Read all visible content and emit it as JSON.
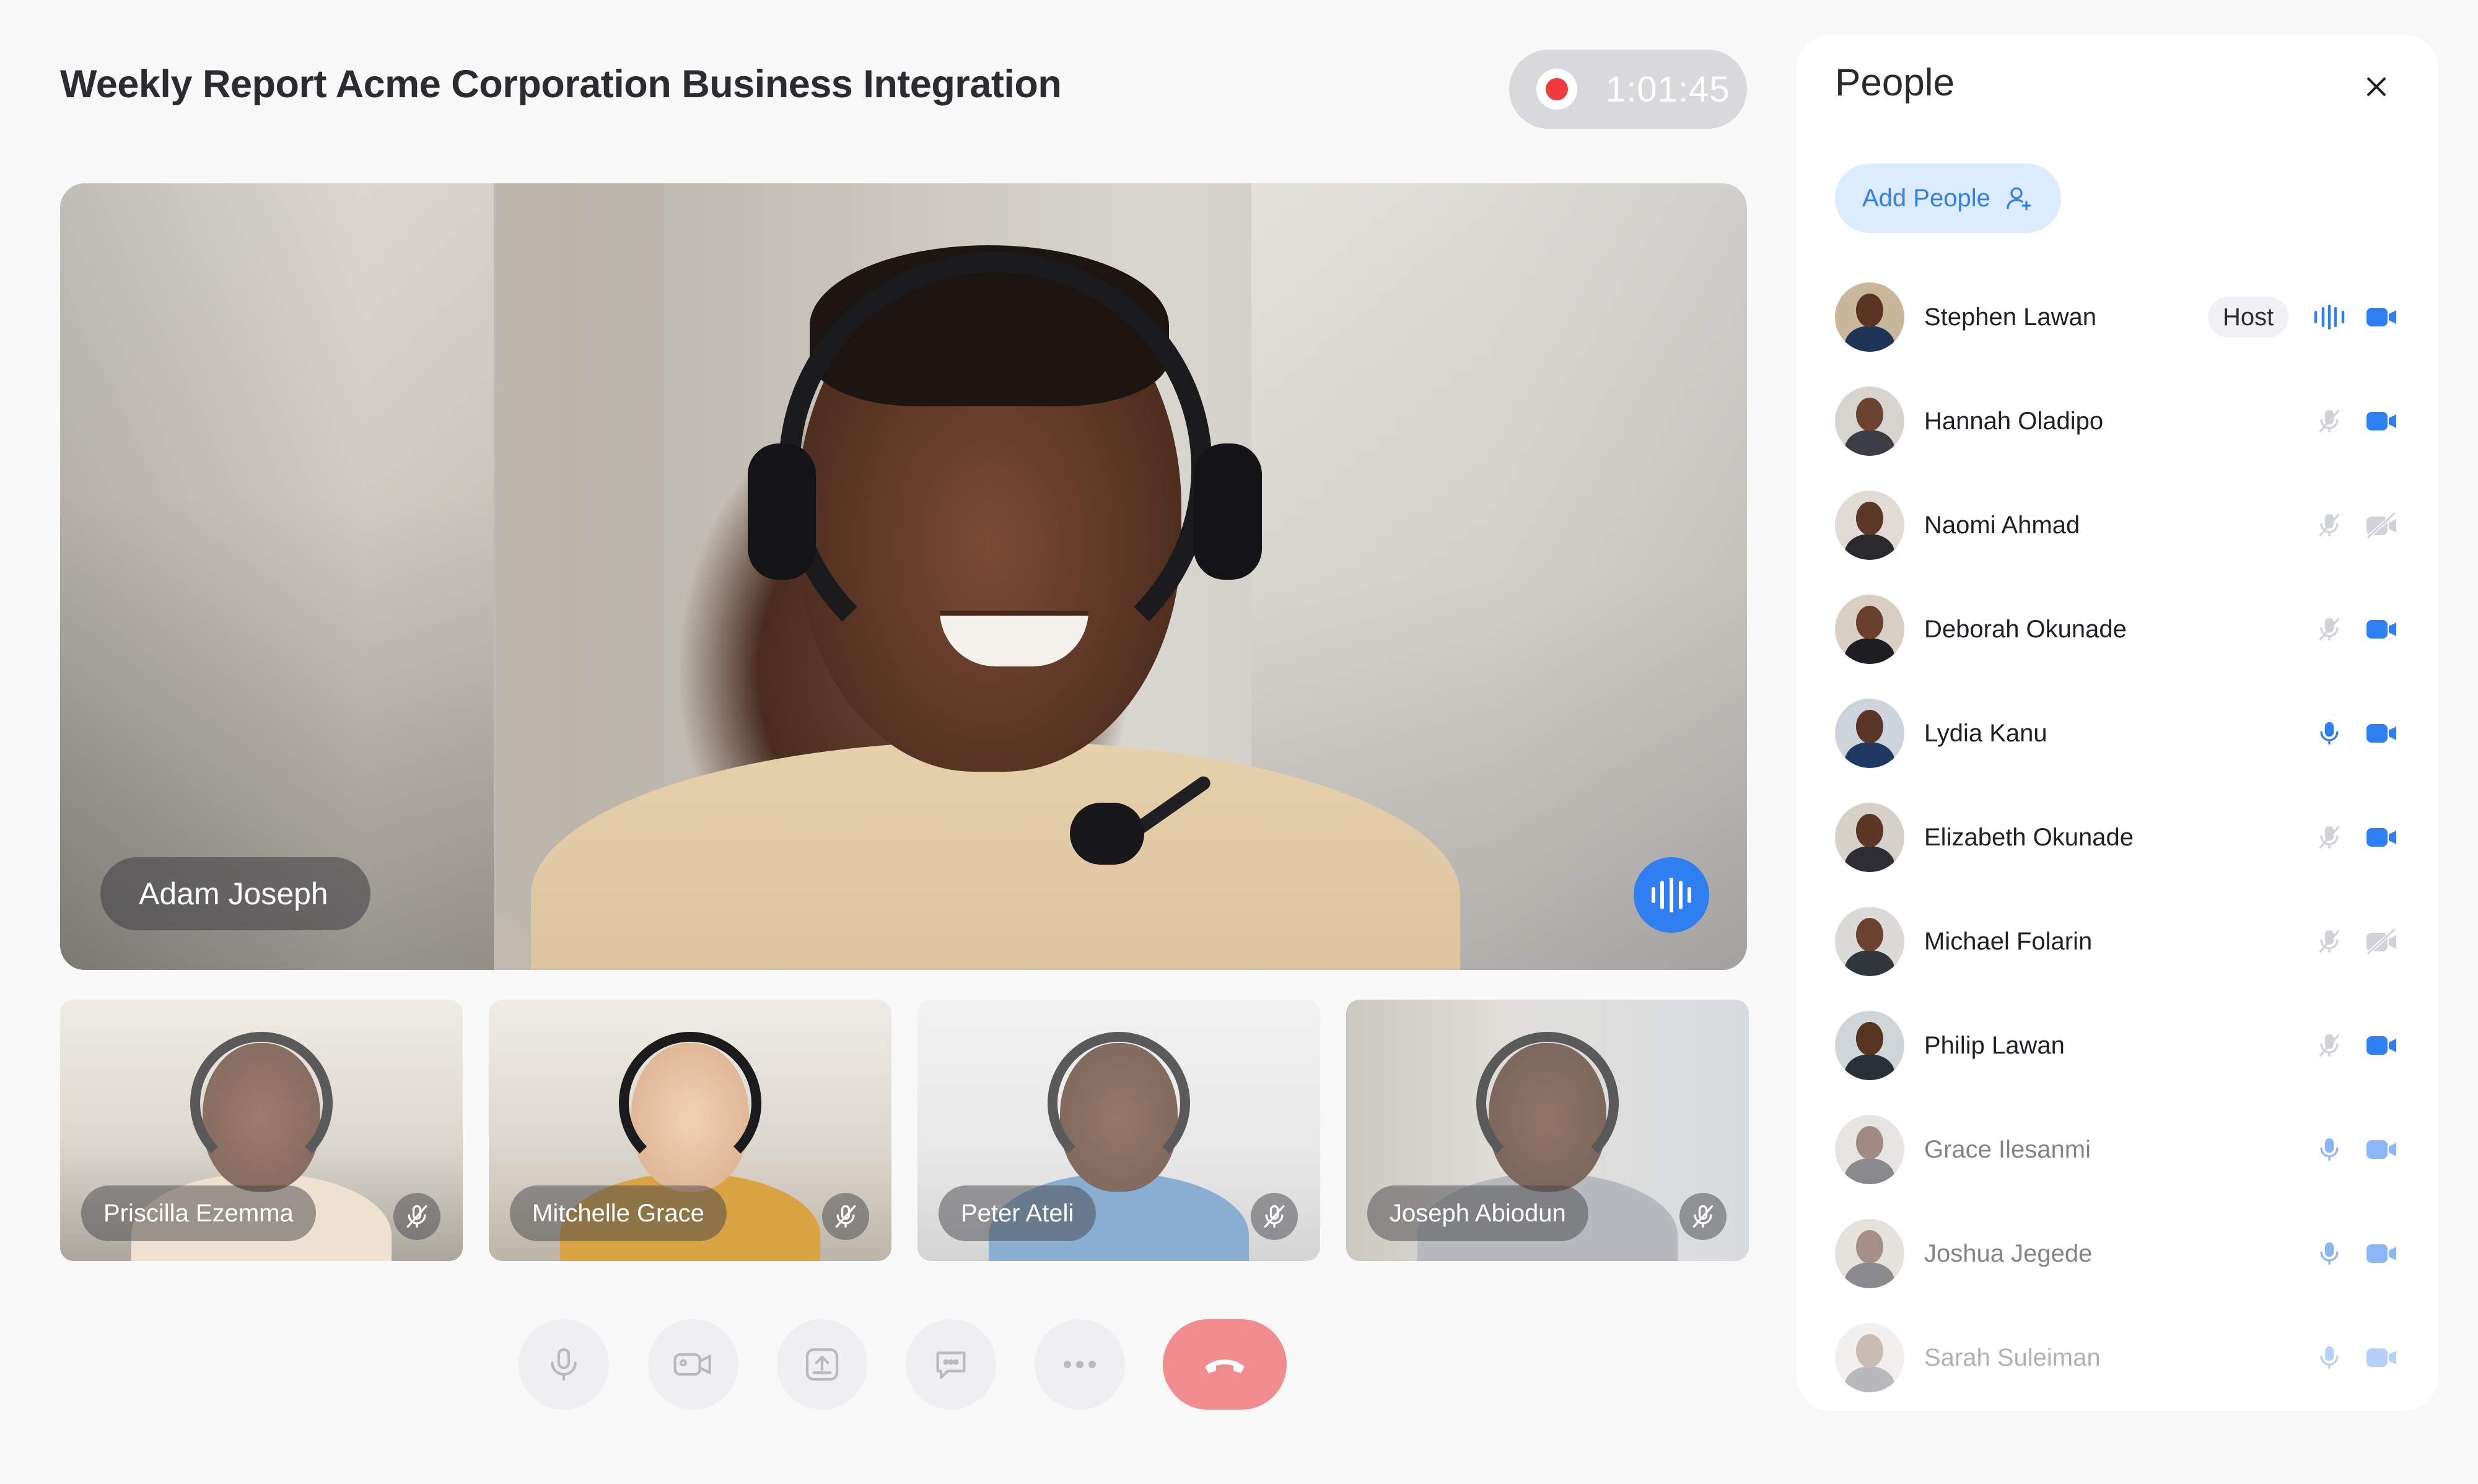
{
  "meeting": {
    "title": "Weekly Report Acme Corporation Business Integration",
    "recording_time": "1:01:45"
  },
  "main_speaker": {
    "name": "Adam Joseph"
  },
  "thumbnails": [
    {
      "name": "Priscilla Ezemma",
      "muted": true
    },
    {
      "name": "Mitchelle Grace",
      "muted": true
    },
    {
      "name": "Peter Ateli",
      "muted": true
    },
    {
      "name": "Joseph Abiodun",
      "muted": true
    }
  ],
  "controls": {
    "icons": [
      "microphone-icon",
      "camera-icon",
      "share-screen-icon",
      "chat-icon",
      "more-icon",
      "end-call-icon"
    ]
  },
  "people_panel": {
    "title": "People",
    "add_people_label": "Add People",
    "host_label": "Host",
    "participants": [
      {
        "name": "Stephen Lawan",
        "host": true,
        "mic": "speaking",
        "camera": "on"
      },
      {
        "name": "Hannah Oladipo",
        "host": false,
        "mic": "muted",
        "camera": "on"
      },
      {
        "name": "Naomi Ahmad",
        "host": false,
        "mic": "muted",
        "camera": "off"
      },
      {
        "name": "Deborah Okunade",
        "host": false,
        "mic": "muted",
        "camera": "on"
      },
      {
        "name": "Lydia Kanu",
        "host": false,
        "mic": "on",
        "camera": "on"
      },
      {
        "name": "Elizabeth Okunade",
        "host": false,
        "mic": "muted",
        "camera": "on"
      },
      {
        "name": "Michael Folarin",
        "host": false,
        "mic": "muted",
        "camera": "off"
      },
      {
        "name": "Philip Lawan",
        "host": false,
        "mic": "muted",
        "camera": "on"
      },
      {
        "name": "Grace Ilesanmi",
        "host": false,
        "mic": "on",
        "camera": "on"
      },
      {
        "name": "Joshua Jegede",
        "host": false,
        "mic": "on",
        "camera": "on"
      },
      {
        "name": "Sarah Suleiman",
        "host": false,
        "mic": "on",
        "camera": "on"
      }
    ]
  },
  "colors": {
    "accent": "#2f7ef2",
    "record": "#ef3b3b",
    "end_call": "#f08c8e",
    "add_people_bg": "#dcebfd"
  }
}
